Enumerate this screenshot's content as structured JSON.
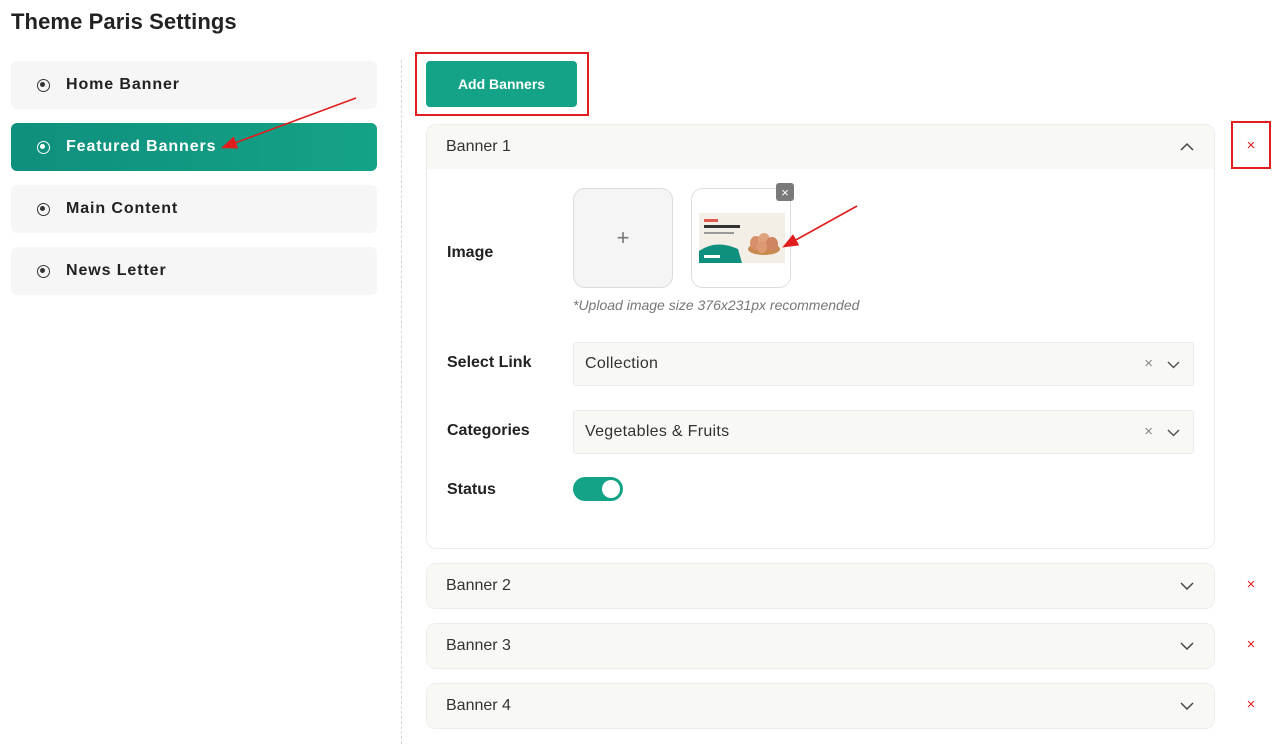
{
  "page": {
    "title": "Theme Paris Settings"
  },
  "sidebar": {
    "items": [
      {
        "label": "Home Banner",
        "active": false
      },
      {
        "label": "Featured Banners",
        "active": true
      },
      {
        "label": "Main Content",
        "active": false
      },
      {
        "label": "News Letter",
        "active": false
      }
    ]
  },
  "toolbar": {
    "add_label": "Add Banners"
  },
  "banners": [
    {
      "title": "Banner 1",
      "expanded": true,
      "fields": {
        "image_label": "Image",
        "upload_plus": "+",
        "image_hint": "*Upload image size 376x231px recommended",
        "link_label": "Select Link",
        "link_value": "Collection",
        "categories_label": "Categories",
        "categories_value": "Vegetables & Fruits",
        "status_label": "Status",
        "status_on": true
      }
    },
    {
      "title": "Banner 2",
      "expanded": false
    },
    {
      "title": "Banner 3",
      "expanded": false
    },
    {
      "title": "Banner 4",
      "expanded": false
    }
  ],
  "icons": {
    "remove": "×",
    "clear": "×"
  },
  "colors": {
    "accent": "#14a386",
    "accent_dark": "#0f8f7e",
    "danger": "#e11d1d",
    "panel": "#f8f8f4"
  }
}
